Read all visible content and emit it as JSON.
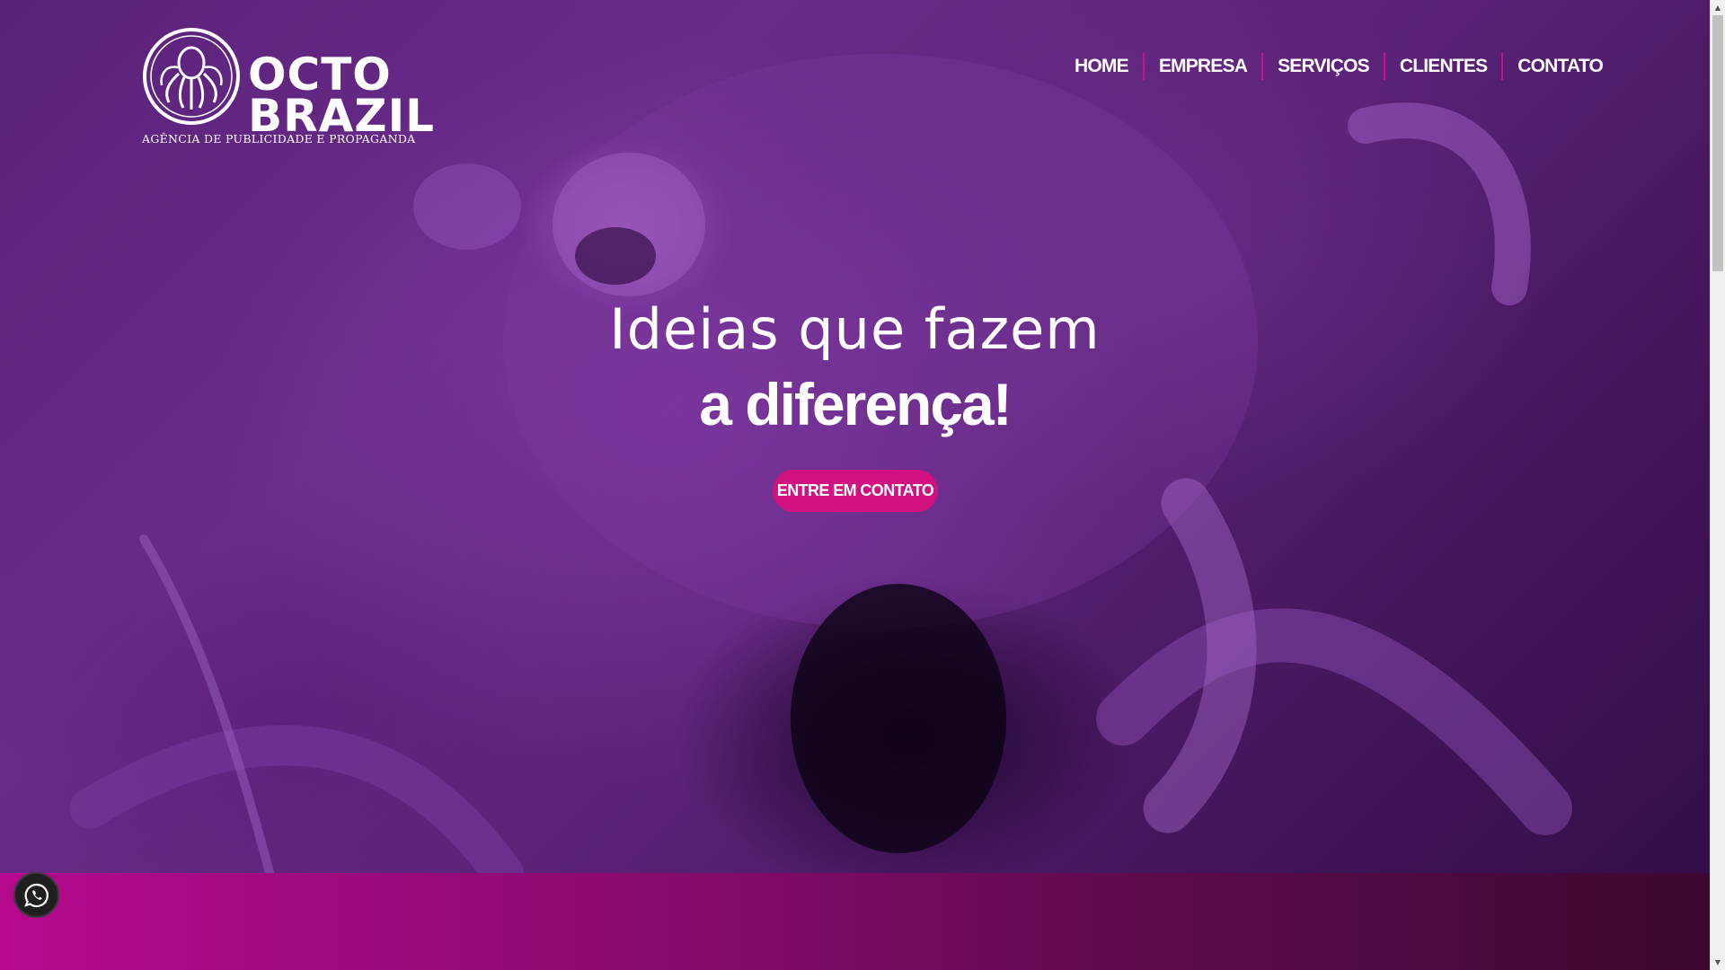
{
  "brand": {
    "word1": "OCTO",
    "word2": "BRAZIL",
    "tagline": "AGÊNCIA DE PUBLICIDADE E PROPAGANDA"
  },
  "nav": {
    "items": [
      {
        "label": "HOME"
      },
      {
        "label": "EMPRESA"
      },
      {
        "label": "SERVIÇOS"
      },
      {
        "label": "CLIENTES"
      },
      {
        "label": "CONTATO"
      }
    ]
  },
  "hero": {
    "headline_line1": "Ideias que fazem",
    "headline_line2": "a diferença!",
    "cta_label": "ENTRE EM CONTATO"
  },
  "floating": {
    "whatsapp_icon": "whatsapp-icon"
  },
  "colors": {
    "accent": "#d1117f",
    "nav_separator": "#c2188f",
    "hero_tint": "#5a2479",
    "band_start": "#b5098f",
    "band_end": "#3c0830"
  }
}
